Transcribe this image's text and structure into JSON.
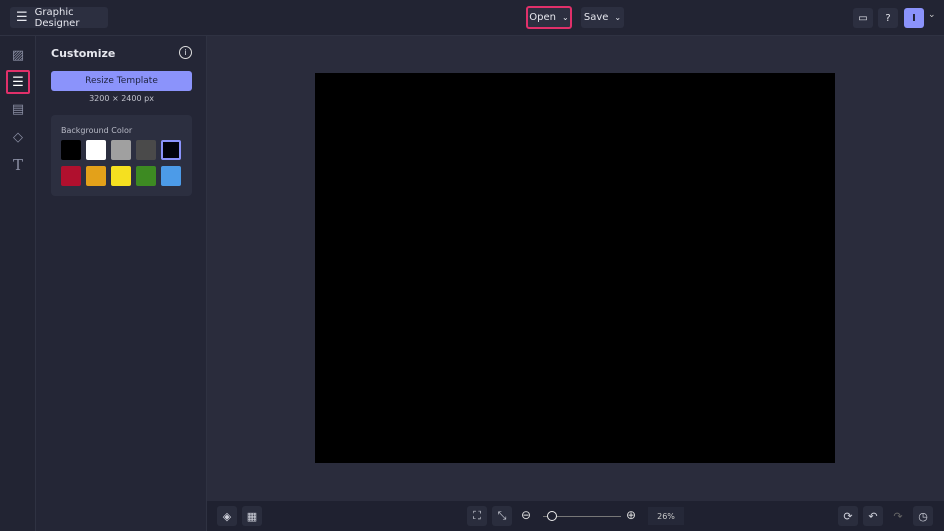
{
  "header": {
    "app_title": "Graphic Designer",
    "open_label": "Open",
    "save_label": "Save",
    "avatar_initial": "I"
  },
  "panel": {
    "title": "Customize",
    "resize_label": "Resize Template",
    "dimensions": "3200 × 2400 px",
    "bg_color_label": "Background Color",
    "swatches": [
      "#000000",
      "#ffffff",
      "#a0a0a0",
      "#4a4a4a",
      "#02020a",
      "#b0102e",
      "#e3a11a",
      "#f5e020",
      "#3d8a22",
      "#4c9be8"
    ]
  },
  "bottom": {
    "zoom_value": "26%",
    "zoom_fraction": 0.05
  },
  "accent": "#8b93fb",
  "highlight": "#e0306a"
}
